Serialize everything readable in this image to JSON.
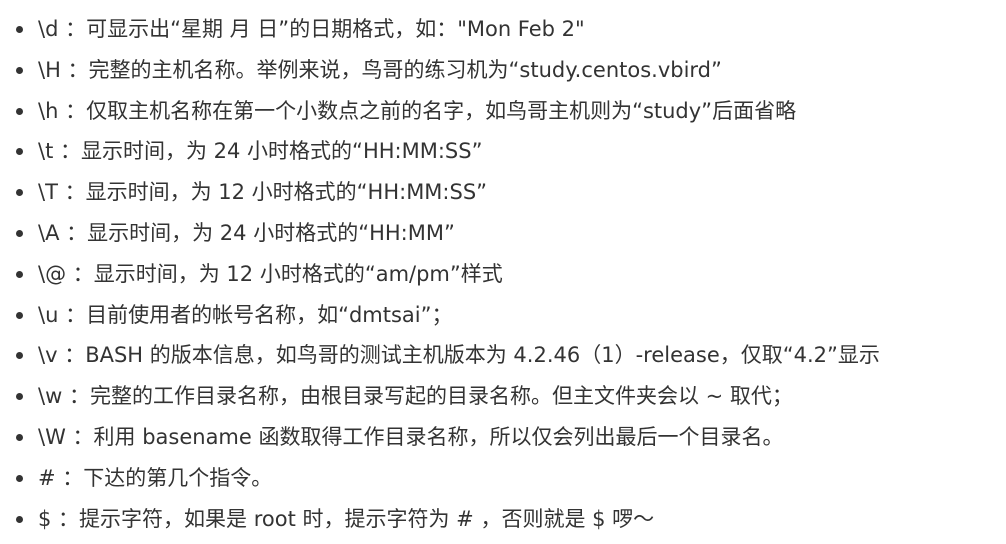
{
  "items": [
    {
      "code": "\\d",
      "desc": " ：可显示出“星期 月 日”的日期格式，如：\"Mon Feb 2\""
    },
    {
      "code": "\\H",
      "desc": " ：完整的主机名称。举例来说，鸟哥的练习机为“study.centos.vbird”"
    },
    {
      "code": "\\h",
      "desc": " ：仅取主机名称在第一个小数点之前的名字，如鸟哥主机则为“study”后面省略"
    },
    {
      "code": "\\t",
      "desc": " ：显示时间，为 24 小时格式的“HH:MM:SS”"
    },
    {
      "code": "\\T",
      "desc": " ：显示时间，为 12 小时格式的“HH:MM:SS”"
    },
    {
      "code": "\\A",
      "desc": " ：显示时间，为 24 小时格式的“HH:MM”"
    },
    {
      "code": "\\@",
      "desc": " ：显示时间，为 12 小时格式的“am/pm”样式"
    },
    {
      "code": "\\u",
      "desc": " ：目前使用者的帐号名称，如“dmtsai”；"
    },
    {
      "code": "\\v",
      "desc": " ：BASH 的版本信息，如鸟哥的测试主机版本为 4.2.46（1）-release，仅取“4.2”显示"
    },
    {
      "code": "\\w",
      "desc": " ：完整的工作目录名称，由根目录写起的目录名称。但主文件夹会以 ~ 取代；"
    },
    {
      "code": "\\W",
      "desc": " ：利用 basename 函数取得工作目录名称，所以仅会列出最后一个目录名。"
    },
    {
      "code": "#",
      "desc": " ：下达的第几个指令。"
    },
    {
      "code": "$",
      "desc": " ：提示字符，如果是 root 时，提示字符为 # ，否则就是 $ 啰～"
    }
  ]
}
